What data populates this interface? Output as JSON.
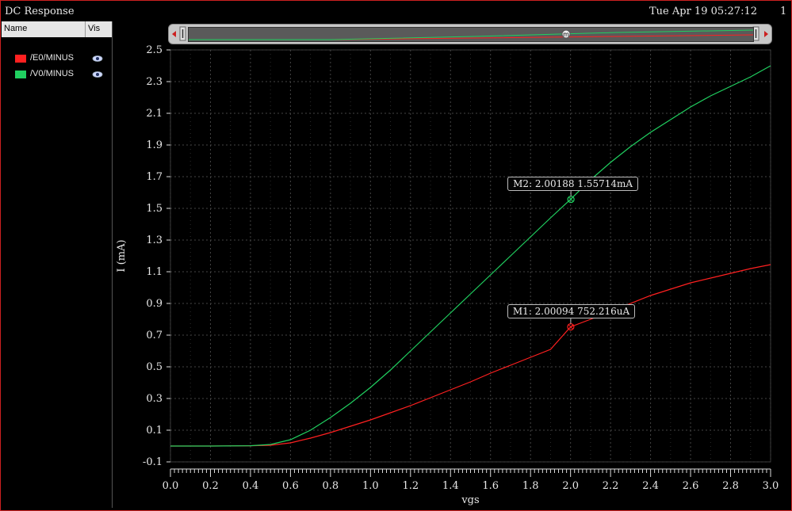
{
  "window": {
    "title": "DC Response",
    "timestamp": "Tue Apr 19 05:27:12",
    "page_number": "1"
  },
  "legend": {
    "col_name": "Name",
    "col_vis": "Vis",
    "items": [
      {
        "label": "/E0/MINUS",
        "color": "#ff2020"
      },
      {
        "label": "/V0/MINUS",
        "color": "#20d060"
      }
    ]
  },
  "scrollbar": {
    "marker_glyph": "m"
  },
  "markers": [
    {
      "label": "M1: 2.00094 752.216uA",
      "x": 2.00094,
      "y": 0.752216,
      "series": "/E0/MINUS"
    },
    {
      "label": "M2: 2.00188 1.55714mA",
      "x": 2.00188,
      "y": 1.55714,
      "series": "/V0/MINUS"
    }
  ],
  "chart_data": {
    "type": "line",
    "xlabel": "vgs",
    "ylabel": "I (mA)",
    "xlim": [
      0.0,
      3.0
    ],
    "ylim": [
      -0.1,
      2.5
    ],
    "xticks": [
      "0.0",
      "0.2",
      "0.4",
      "0.6",
      "0.8",
      "1.0",
      "1.2",
      "1.4",
      "1.6",
      "1.8",
      "2.0",
      "2.2",
      "2.4",
      "2.6",
      "2.8",
      "3.0"
    ],
    "yticks": [
      "-0.1",
      "0.1",
      "0.3",
      "0.5",
      "0.7",
      "0.9",
      "1.1",
      "1.3",
      "1.5",
      "1.7",
      "1.9",
      "2.1",
      "2.3",
      "2.5"
    ],
    "grid": true,
    "x": [
      0.0,
      0.2,
      0.4,
      0.5,
      0.6,
      0.7,
      0.8,
      0.9,
      1.0,
      1.1,
      1.2,
      1.3,
      1.4,
      1.5,
      1.6,
      1.7,
      1.8,
      1.9,
      2.0,
      2.1,
      2.2,
      2.3,
      2.4,
      2.5,
      2.6,
      2.7,
      2.8,
      2.9,
      3.0
    ],
    "series": [
      {
        "name": "/E0/MINUS",
        "color": "#ff2020",
        "values": [
          0.0,
          0.0,
          0.002,
          0.005,
          0.02,
          0.05,
          0.085,
          0.125,
          0.165,
          0.21,
          0.255,
          0.305,
          0.355,
          0.405,
          0.46,
          0.51,
          0.56,
          0.61,
          0.752,
          0.8,
          0.85,
          0.9,
          0.95,
          0.99,
          1.03,
          1.06,
          1.09,
          1.12,
          1.145
        ]
      },
      {
        "name": "/V0/MINUS",
        "color": "#20d060",
        "values": [
          0.0,
          0.0,
          0.002,
          0.01,
          0.04,
          0.1,
          0.18,
          0.27,
          0.37,
          0.48,
          0.6,
          0.72,
          0.84,
          0.96,
          1.08,
          1.2,
          1.32,
          1.44,
          1.557,
          1.68,
          1.79,
          1.89,
          1.98,
          2.06,
          2.14,
          2.21,
          2.27,
          2.33,
          2.4
        ]
      }
    ]
  }
}
